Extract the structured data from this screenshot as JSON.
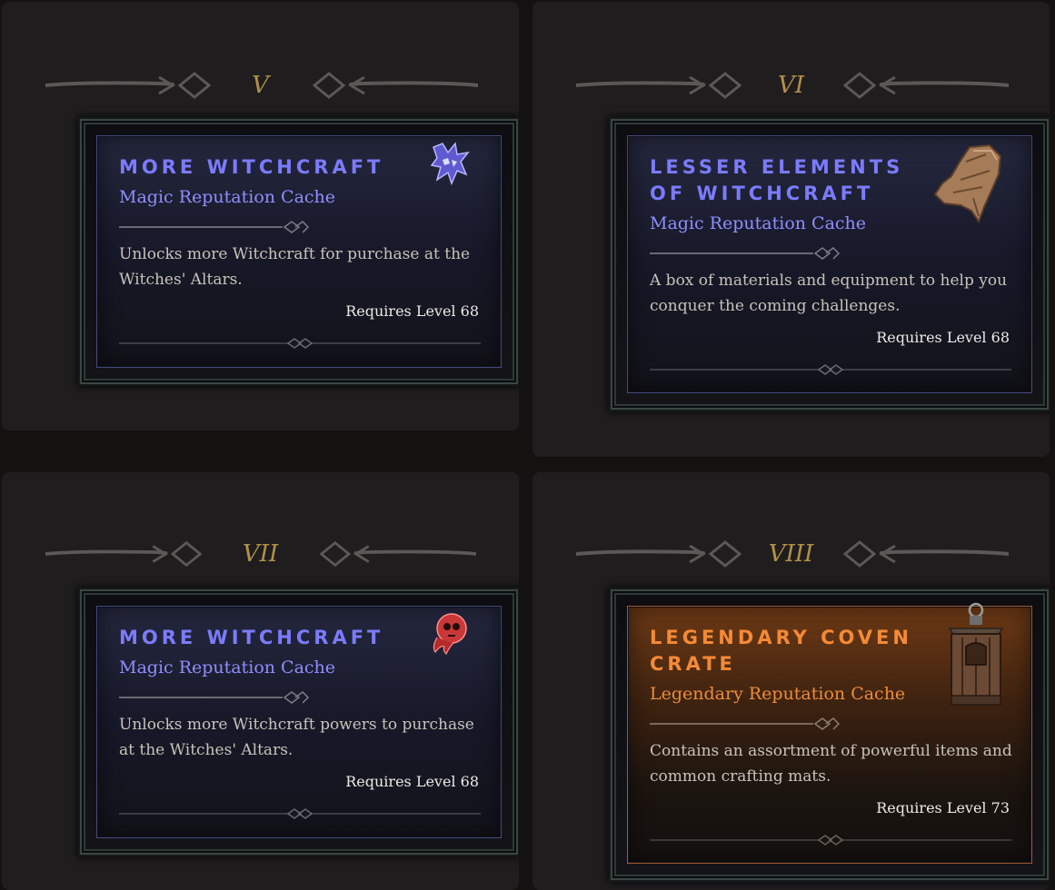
{
  "tiers": [
    {
      "label": "V",
      "card": {
        "title": "More Witchcraft",
        "subtitle": "Magic Reputation Cache",
        "description": "Unlocks more Witchcraft for purchase at the Witches' Altars.",
        "requirement": "Requires Level 68",
        "rarity": "magic",
        "icon": "wolf-sigil-icon"
      }
    },
    {
      "label": "VI",
      "card": {
        "title": "Lesser Elements of Witchcraft",
        "subtitle": "Magic Reputation Cache",
        "description": "A box of materials and equipment to help you conquer the coming challenges.",
        "requirement": "Requires Level 68",
        "rarity": "magic",
        "icon": "leather-scrap-icon"
      }
    },
    {
      "label": "VII",
      "card": {
        "title": "More Witchcraft",
        "subtitle": "Magic Reputation Cache",
        "description": "Unlocks more Witchcraft powers to purchase at the Witches' Altars.",
        "requirement": "Requires Level 68",
        "rarity": "magic",
        "icon": "red-skull-icon"
      }
    },
    {
      "label": "VIII",
      "card": {
        "title": "Legendary Coven Crate",
        "subtitle": "Legendary Reputation Cache",
        "description": "Contains an assortment of powerful items and common crafting mats.",
        "requirement": "Requires Level 73",
        "rarity": "legendary",
        "icon": "lantern-crate-icon"
      }
    }
  ],
  "colors": {
    "background": "#141211",
    "panel": "#1f1d1e",
    "tier_label": "#b39048",
    "magic_title": "#7b7bff",
    "legendary_title": "#f58a36",
    "description": "#c8c3ba",
    "requirement": "#ecebe6"
  }
}
